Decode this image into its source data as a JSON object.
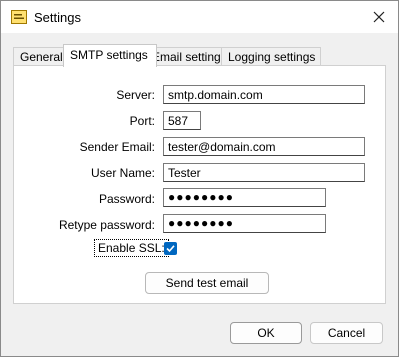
{
  "window": {
    "title": "Settings",
    "close_icon": "close-icon",
    "app_icon": "settings-app-icon"
  },
  "tabs": [
    {
      "label": "General",
      "active": false
    },
    {
      "label": "SMTP settings",
      "active": true
    },
    {
      "label": "Email settings",
      "active": false
    },
    {
      "label": "Logging settings",
      "active": false
    }
  ],
  "smtp": {
    "server_label": "Server:",
    "server_value": "smtp.domain.com",
    "port_label": "Port:",
    "port_value": "587",
    "sender_label": "Sender Email:",
    "sender_value": "tester@domain.com",
    "username_label": "User Name:",
    "username_value": "Tester",
    "password_label": "Password:",
    "password_value": "●●●●●●●●",
    "retype_label": "Retype password:",
    "retype_value": "●●●●●●●●",
    "ssl_label": "Enable SSL:",
    "ssl_checked": true,
    "test_button": "Send test email"
  },
  "footer": {
    "ok_label": "OK",
    "cancel_label": "Cancel"
  },
  "colors": {
    "accent": "#0067c0",
    "panel": "#ffffff",
    "dialog": "#f0f0f0"
  }
}
